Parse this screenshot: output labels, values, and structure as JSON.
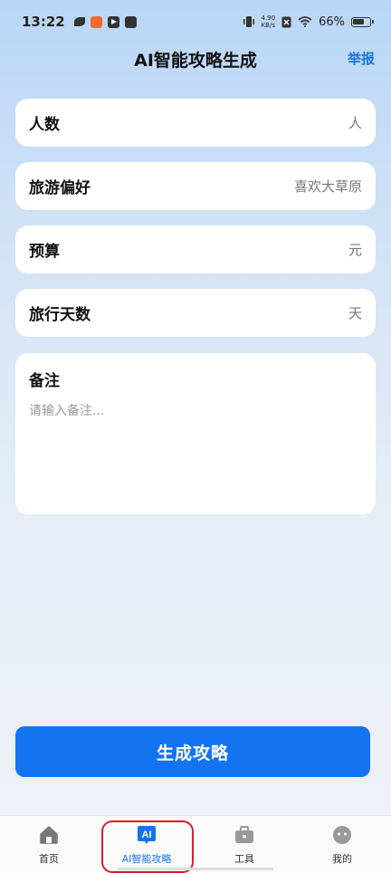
{
  "status_bar": {
    "time": "13:22",
    "net_speed_value": "4.90",
    "net_speed_unit": "KB/s",
    "battery": "66%"
  },
  "header": {
    "title": "AI智能攻略生成",
    "report_label": "举报"
  },
  "form": {
    "people": {
      "label": "人数",
      "suffix": "人"
    },
    "preference": {
      "label": "旅游偏好",
      "suffix": "喜欢大草原"
    },
    "budget": {
      "label": "预算",
      "suffix": "元"
    },
    "days": {
      "label": "旅行天数",
      "suffix": "天"
    },
    "remark": {
      "label": "备注",
      "placeholder": "请输入备注..."
    }
  },
  "generate_button_label": "生成攻略",
  "tabs": [
    {
      "label": "首页",
      "icon": "home-icon"
    },
    {
      "label": "AI智能攻略",
      "icon": "ai-icon"
    },
    {
      "label": "工具",
      "icon": "toolbox-icon"
    },
    {
      "label": "我的",
      "icon": "profile-icon"
    }
  ],
  "colors": {
    "accent": "#1473f1",
    "highlight": "#d81e2a"
  }
}
